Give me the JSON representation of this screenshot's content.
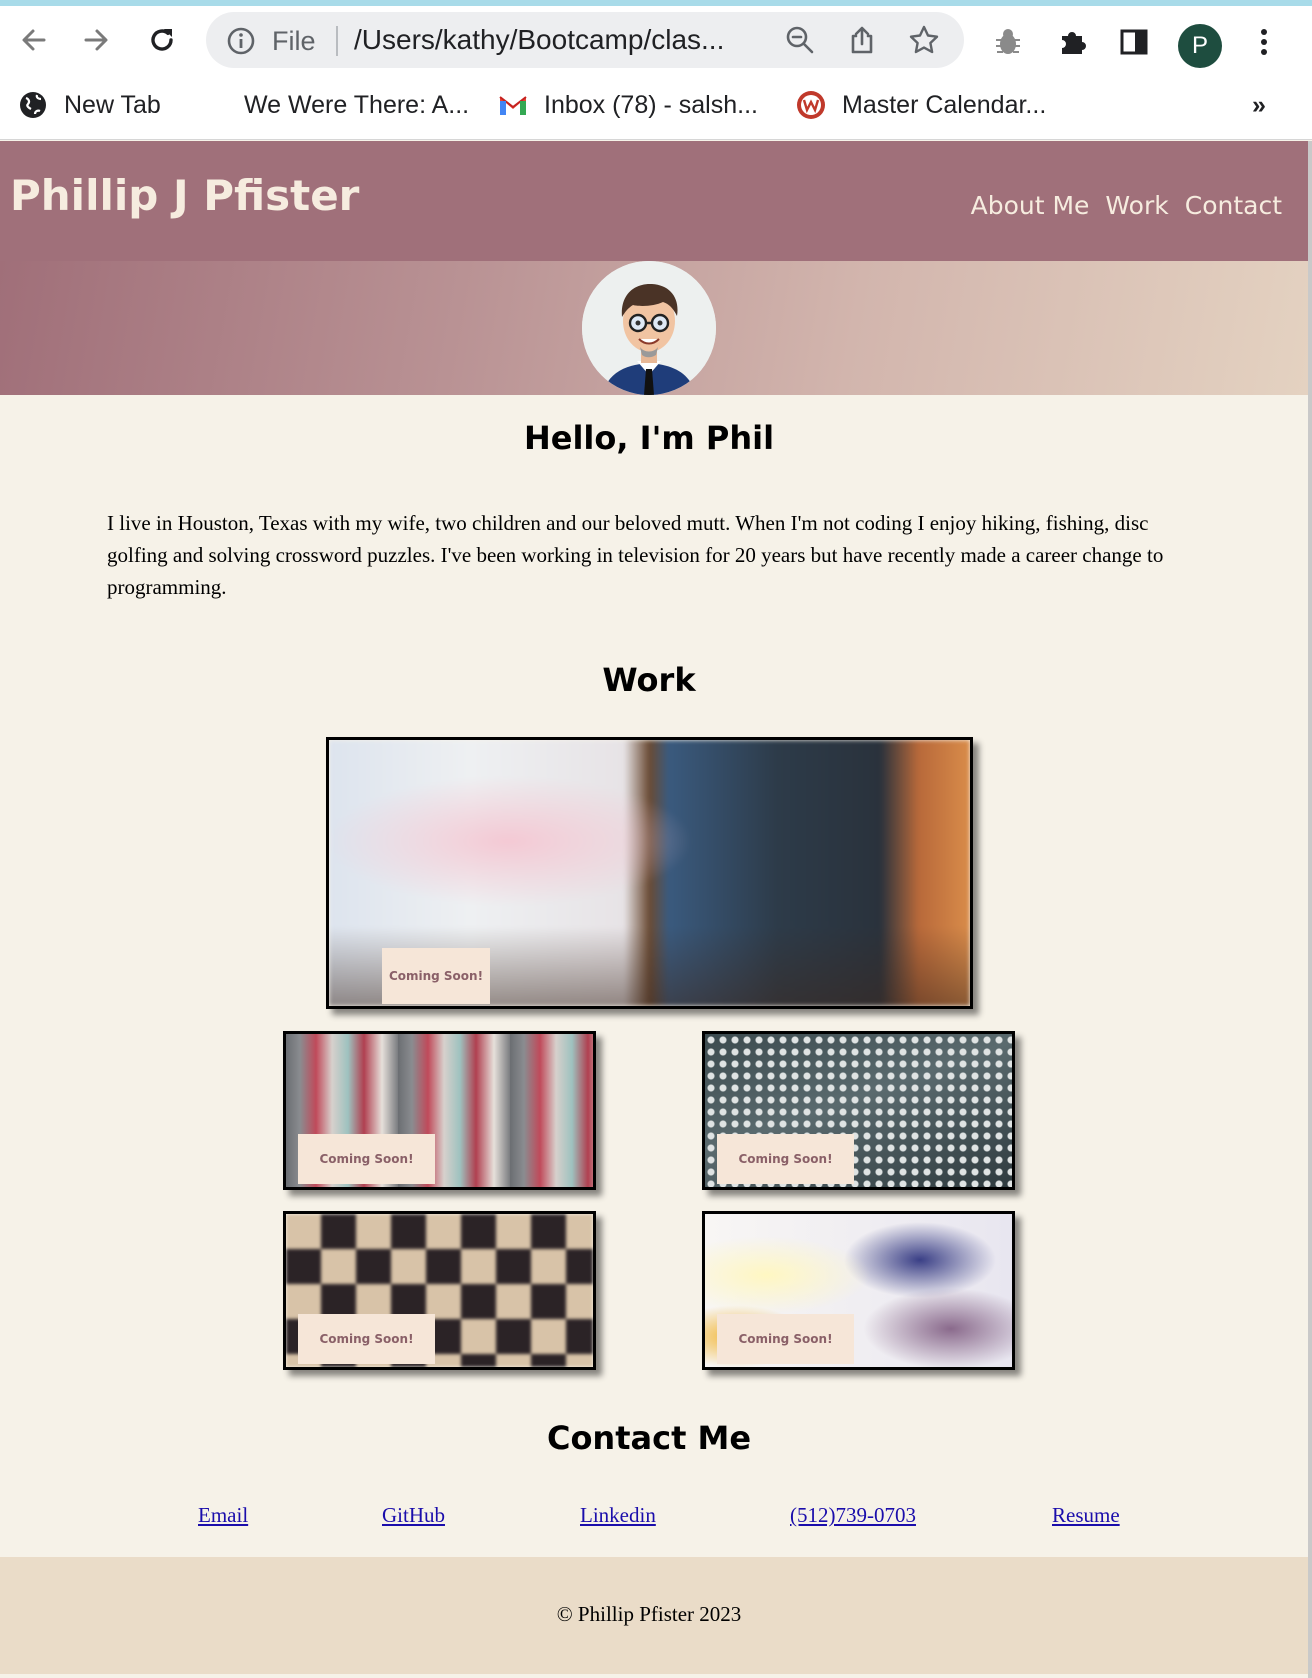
{
  "browser": {
    "address_scheme": "File",
    "address_url": "/Users/kathy/Bootcamp/clas...",
    "profile_initial": "P",
    "bookmarks": [
      {
        "label": "New Tab",
        "icon": "globe-icon"
      },
      {
        "label": "We Were There: A...",
        "icon": "none"
      },
      {
        "label": "Inbox (78) - salsh...",
        "icon": "gmail-icon"
      },
      {
        "label": "Master Calendar...",
        "icon": "w-icon"
      }
    ],
    "overflow": "»"
  },
  "site": {
    "title": "Phillip J Pfister",
    "nav": [
      {
        "label": "About Me"
      },
      {
        "label": "Work"
      },
      {
        "label": "Contact"
      }
    ]
  },
  "about": {
    "heading": "Hello, I'm Phil",
    "text": "I live in Houston, Texas with my wife, two children and our beloved mutt. When I'm not coding I enjoy hiking, fishing, disc golfing and solving crossword puzzles. I've been working in television for 20 years but have recently made a career change to programming."
  },
  "work": {
    "heading": "Work",
    "projects": [
      {
        "badge": "Coming Soon!"
      },
      {
        "badge": "Coming Soon!"
      },
      {
        "badge": "Coming Soon!"
      },
      {
        "badge": "Coming Soon!"
      },
      {
        "badge": "Coming Soon!"
      }
    ]
  },
  "contact": {
    "heading": "Contact Me",
    "links": [
      {
        "label": "Email"
      },
      {
        "label": "GitHub"
      },
      {
        "label": "Linkedin"
      },
      {
        "label": "(512)739-0703"
      },
      {
        "label": "Resume"
      }
    ]
  },
  "footer": {
    "text": "© Phillip Pfister 2023"
  },
  "colors": {
    "header": "#a0707a",
    "page_bg": "#f6f2e8",
    "footer_bg": "#eadcc8",
    "link": "#1a0dab"
  }
}
